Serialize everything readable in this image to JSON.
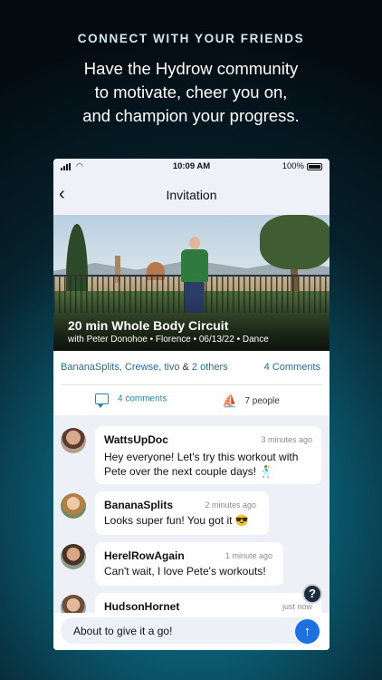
{
  "promo": {
    "eyebrow": "CONNECT WITH YOUR FRIENDS",
    "headline_line1": "Have the Hydrow community",
    "headline_line2": "to motivate, cheer you on,",
    "headline_line3": "and champion your progress."
  },
  "status_bar": {
    "time": "10:09 AM",
    "battery": "100%"
  },
  "nav": {
    "title": "Invitation"
  },
  "workout": {
    "title": "20 min Whole Body Circuit",
    "subtitle_prefix": "with ",
    "instructor": "Peter Donohoe",
    "location": "Florence",
    "date": "06/13/22",
    "category": "Dance",
    "separator": " • "
  },
  "participants": {
    "names": "BananaSplits, Crewse, tivo",
    "and": " & ",
    "others": "2 others",
    "comments_link": "4 Comments"
  },
  "stats": {
    "comments": "4 comments",
    "people": "7 people"
  },
  "comments": [
    {
      "name": "WattsUpDoc",
      "time": "3 minutes ago",
      "text": "Hey everyone! Let's try this workout with Pete over the next couple days! 🕺"
    },
    {
      "name": "BananaSplits",
      "time": "2 minutes ago",
      "text": "Looks super fun! You got it 😎"
    },
    {
      "name": "HerelRowAgain",
      "time": "1 minute ago",
      "text": "Can't wait, I love Pete's workouts!"
    },
    {
      "name": "HudsonHornet",
      "time": "just now",
      "text": ""
    }
  ],
  "composer": {
    "value": "About to give it a go!"
  },
  "icons": {
    "back": "chevron-left-icon",
    "comments": "speech-bubble-icon",
    "people": "rower-icon",
    "help": "help-icon",
    "send": "arrow-up-icon"
  },
  "colors": {
    "link": "#2a6a93",
    "accent": "#2a86a8",
    "send": "#1e6fe0"
  }
}
